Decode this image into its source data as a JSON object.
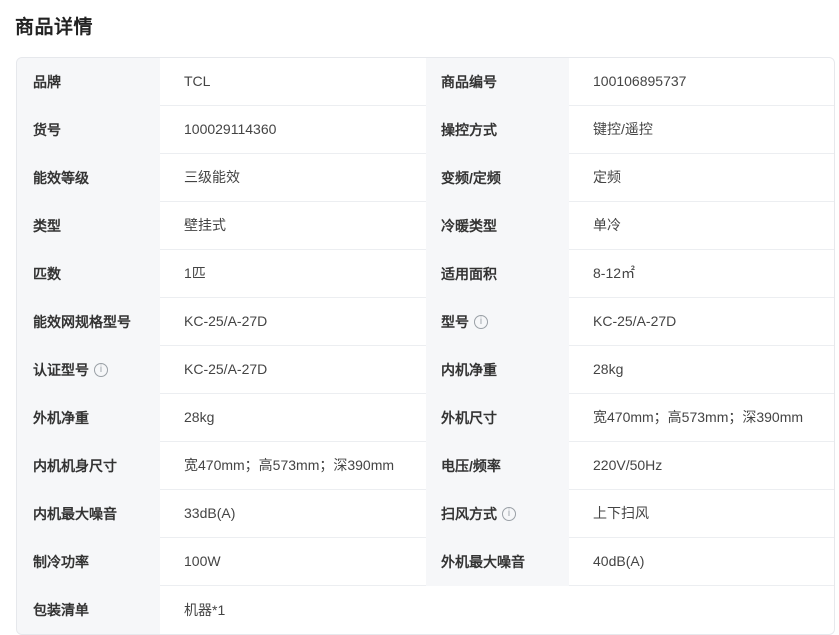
{
  "page_title": "商品详情",
  "rows": [
    {
      "k1": "品牌",
      "v1": "TCL",
      "k2": "商品编号",
      "v2": "100106895737"
    },
    {
      "k1": "货号",
      "v1": "100029114360",
      "k2": "操控方式",
      "v2": "键控/遥控"
    },
    {
      "k1": "能效等级",
      "v1": "三级能效",
      "k2": "变频/定频",
      "v2": "定频"
    },
    {
      "k1": "类型",
      "v1": "壁挂式",
      "k2": "冷暖类型",
      "v2": "单冷"
    },
    {
      "k1": "匹数",
      "v1": "1匹",
      "k2": "适用面积",
      "v2": "8-12㎡"
    },
    {
      "k1": "能效网规格型号",
      "v1": "KC-25/A-27D",
      "k2": "型号",
      "v2": "KC-25/A-27D"
    },
    {
      "k1": "认证型号",
      "v1": "KC-25/A-27D",
      "k2": "内机净重",
      "v2": "28kg"
    },
    {
      "k1": "外机净重",
      "v1": "28kg",
      "k2": "外机尺寸",
      "v2": "宽470mm；高573mm；深390mm"
    },
    {
      "k1": "内机机身尺寸",
      "v1": "宽470mm；高573mm；深390mm",
      "k2": "电压/频率",
      "v2": "220V/50Hz"
    },
    {
      "k1": "内机最大噪音",
      "v1": "33dB(A)",
      "k2": "扫风方式",
      "v2": "上下扫风"
    },
    {
      "k1": "制冷功率",
      "v1": "100W",
      "k2": "外机最大噪音",
      "v2": "40dB(A)"
    },
    {
      "k1": "包装清单",
      "v1": "机器*1"
    }
  ],
  "info_icon": "i"
}
